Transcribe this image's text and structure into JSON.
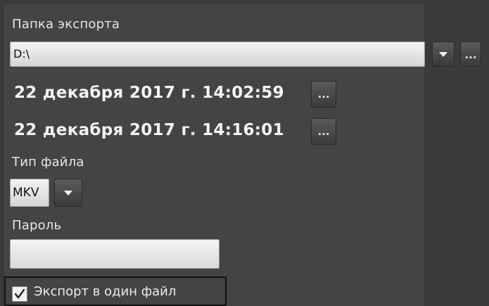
{
  "export_folder": {
    "label": "Папка экспорта",
    "value": "D:\\",
    "browse_label": "..."
  },
  "range": {
    "start": "22 декабря 2017 г. 14:02:59",
    "end": "22 декабря 2017 г. 14:16:01",
    "picker_label": "..."
  },
  "file_type": {
    "label": "Тип файла",
    "value": "MKV"
  },
  "password": {
    "label": "Пароль",
    "value": ""
  },
  "single_file": {
    "label": "Экспорт в один файл",
    "checked": true
  },
  "colors": {
    "panel": "#444444",
    "background": "#3e3e3e",
    "field": "#e8e8e8",
    "text": "#e6e6e6",
    "highlight_border": "#111111"
  },
  "icons": [
    "chevron-down-icon",
    "more-dots-icon",
    "checkmark-icon"
  ]
}
